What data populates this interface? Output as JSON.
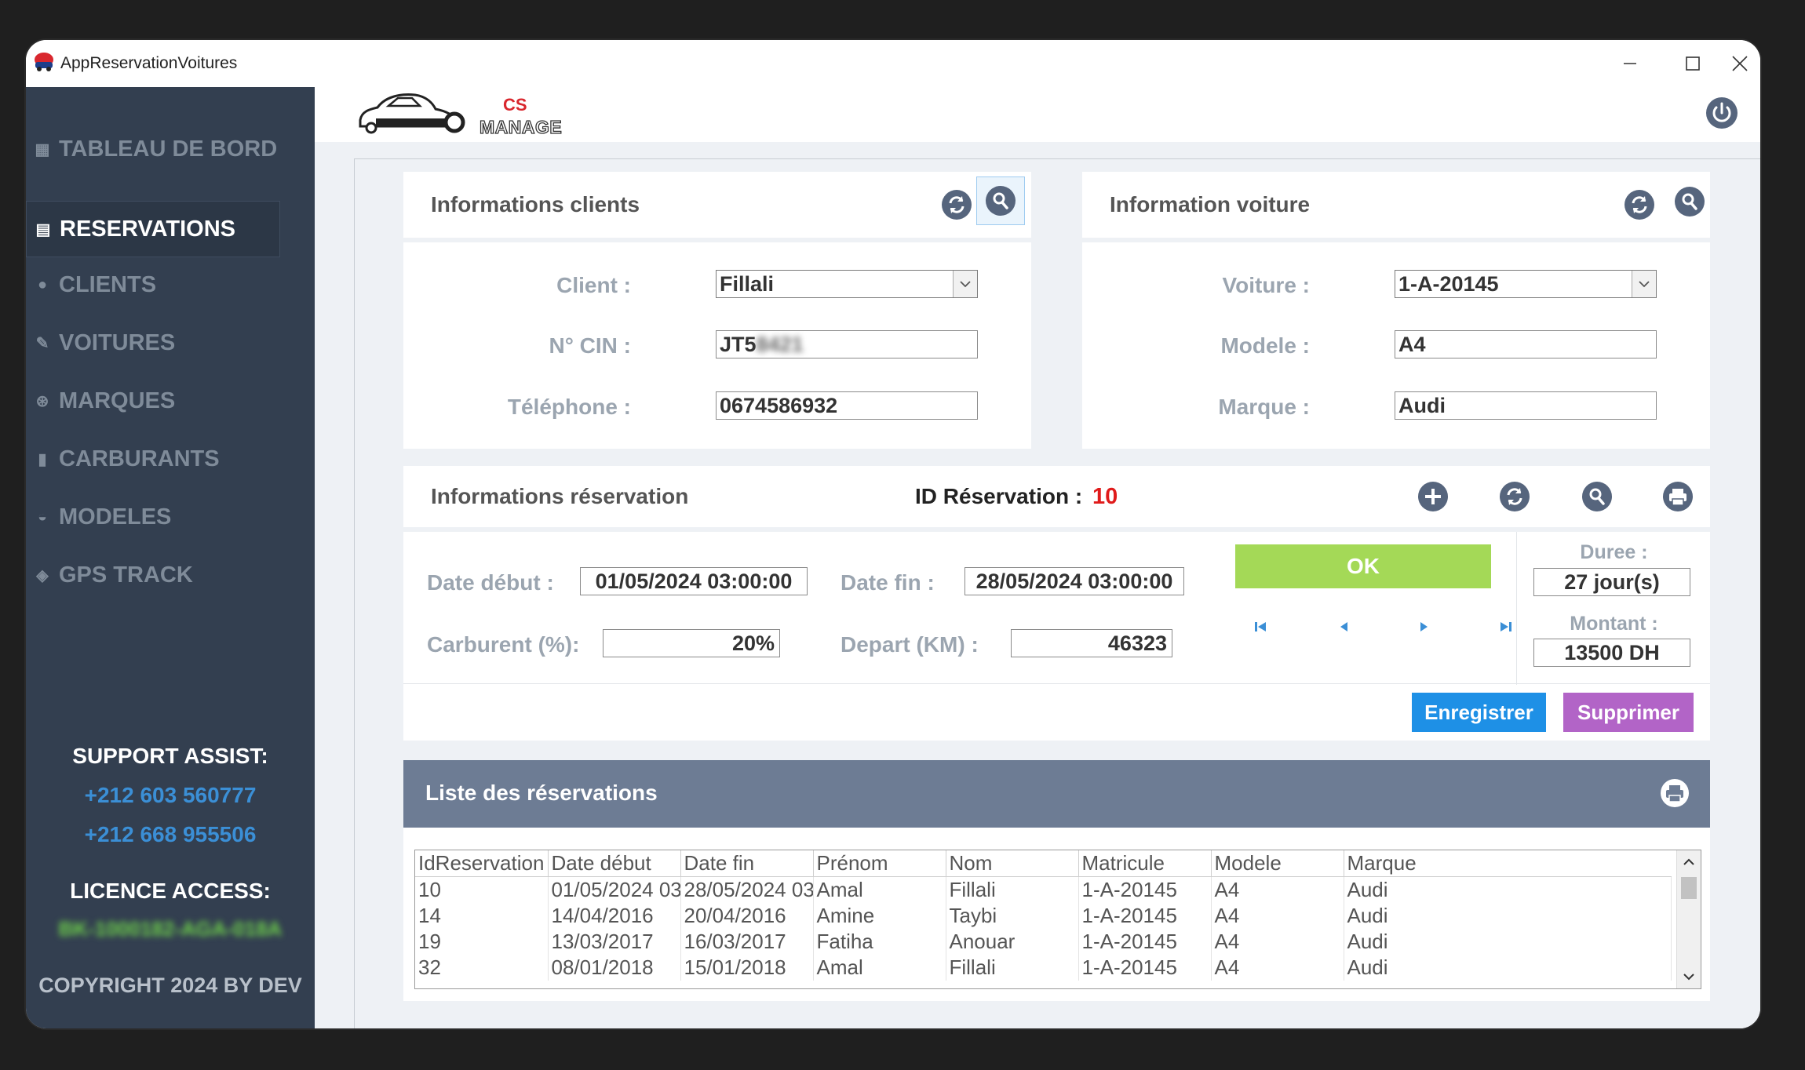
{
  "window": {
    "title": "AppReservationVoitures"
  },
  "brand": {
    "cs": "CS",
    "manage": "MANAGE"
  },
  "sidebar": {
    "items": [
      {
        "label": "TABLEAU DE BORD",
        "icon": "dashboard-icon"
      },
      {
        "label": "RESERVATIONS",
        "icon": "table-icon"
      },
      {
        "label": "CLIENTS",
        "icon": "user-icon"
      },
      {
        "label": "VOITURES",
        "icon": "wrench-icon"
      },
      {
        "label": "MARQUES",
        "icon": "badge-icon"
      },
      {
        "label": "CARBURANTS",
        "icon": "fuel-icon"
      },
      {
        "label": "MODELES",
        "icon": "car-icon"
      },
      {
        "label": "GPS TRACK",
        "icon": "map-pin-icon"
      }
    ],
    "support_title": "SUPPORT ASSIST:",
    "phone1": "+212 603 560777",
    "phone2": "+212 668 955506",
    "licence_title": "LICENCE ACCESS:",
    "licence_key": "BK-1000182-AGA-018A",
    "copyright": "COPYRIGHT 2024 BY DEV"
  },
  "clients_panel": {
    "title": "Informations clients",
    "client_label": "Client :",
    "client_value": "Fillali",
    "cin_label": "N° CIN :",
    "cin_visible": "JT5",
    "cin_hidden": "8421",
    "tel_label": "Téléphone :",
    "tel_value": "0674586932"
  },
  "car_panel": {
    "title": "Information voiture",
    "voiture_label": "Voiture :",
    "voiture_value": "1-A-20145",
    "modele_label": "Modele :",
    "modele_value": "A4",
    "marque_label": "Marque :",
    "marque_value": "Audi"
  },
  "reservation_panel": {
    "title": "Informations réservation",
    "id_label": "ID Réservation :",
    "id_value": "10",
    "date_debut_label": "Date début :",
    "date_debut_value": "01/05/2024 03:00:00",
    "date_fin_label": "Date fin :",
    "date_fin_value": "28/05/2024 03:00:00",
    "carburant_label": "Carburent (%):",
    "carburant_value": "20%",
    "depart_label": "Depart (KM) :",
    "depart_value": "46323",
    "ok_label": "OK",
    "duree_label": "Duree :",
    "duree_value": "27 jour(s)",
    "montant_label": "Montant :",
    "montant_value": "13500 DH",
    "save_label": "Enregistrer",
    "delete_label": "Supprimer"
  },
  "list": {
    "title": "Liste des réservations",
    "columns": [
      "IdReservation",
      "Date début",
      "Date fin",
      "Prénom",
      "Nom",
      "Matricule",
      "Modele",
      "Marque"
    ],
    "rows": [
      [
        "10",
        "01/05/2024 03",
        "28/05/2024 03",
        "Amal",
        "Fillali",
        "1-A-20145",
        "A4",
        "Audi"
      ],
      [
        "14",
        "14/04/2016",
        "20/04/2016",
        "Amine",
        "Taybi",
        "1-A-20145",
        "A4",
        "Audi"
      ],
      [
        "19",
        "13/03/2017",
        "16/03/2017",
        "Fatiha",
        "Anouar",
        "1-A-20145",
        "A4",
        "Audi"
      ],
      [
        "32",
        "08/01/2018",
        "15/01/2018",
        "Amal",
        "Fillali",
        "1-A-20145",
        "A4",
        "Audi"
      ]
    ]
  },
  "colors": {
    "sidebar_bg": "#333f50",
    "accent_blue": "#1e90e6",
    "ok_green": "#a4d957",
    "delete_purple": "#b264c7",
    "id_red": "#e01b1b",
    "list_header": "#6d7c94"
  }
}
